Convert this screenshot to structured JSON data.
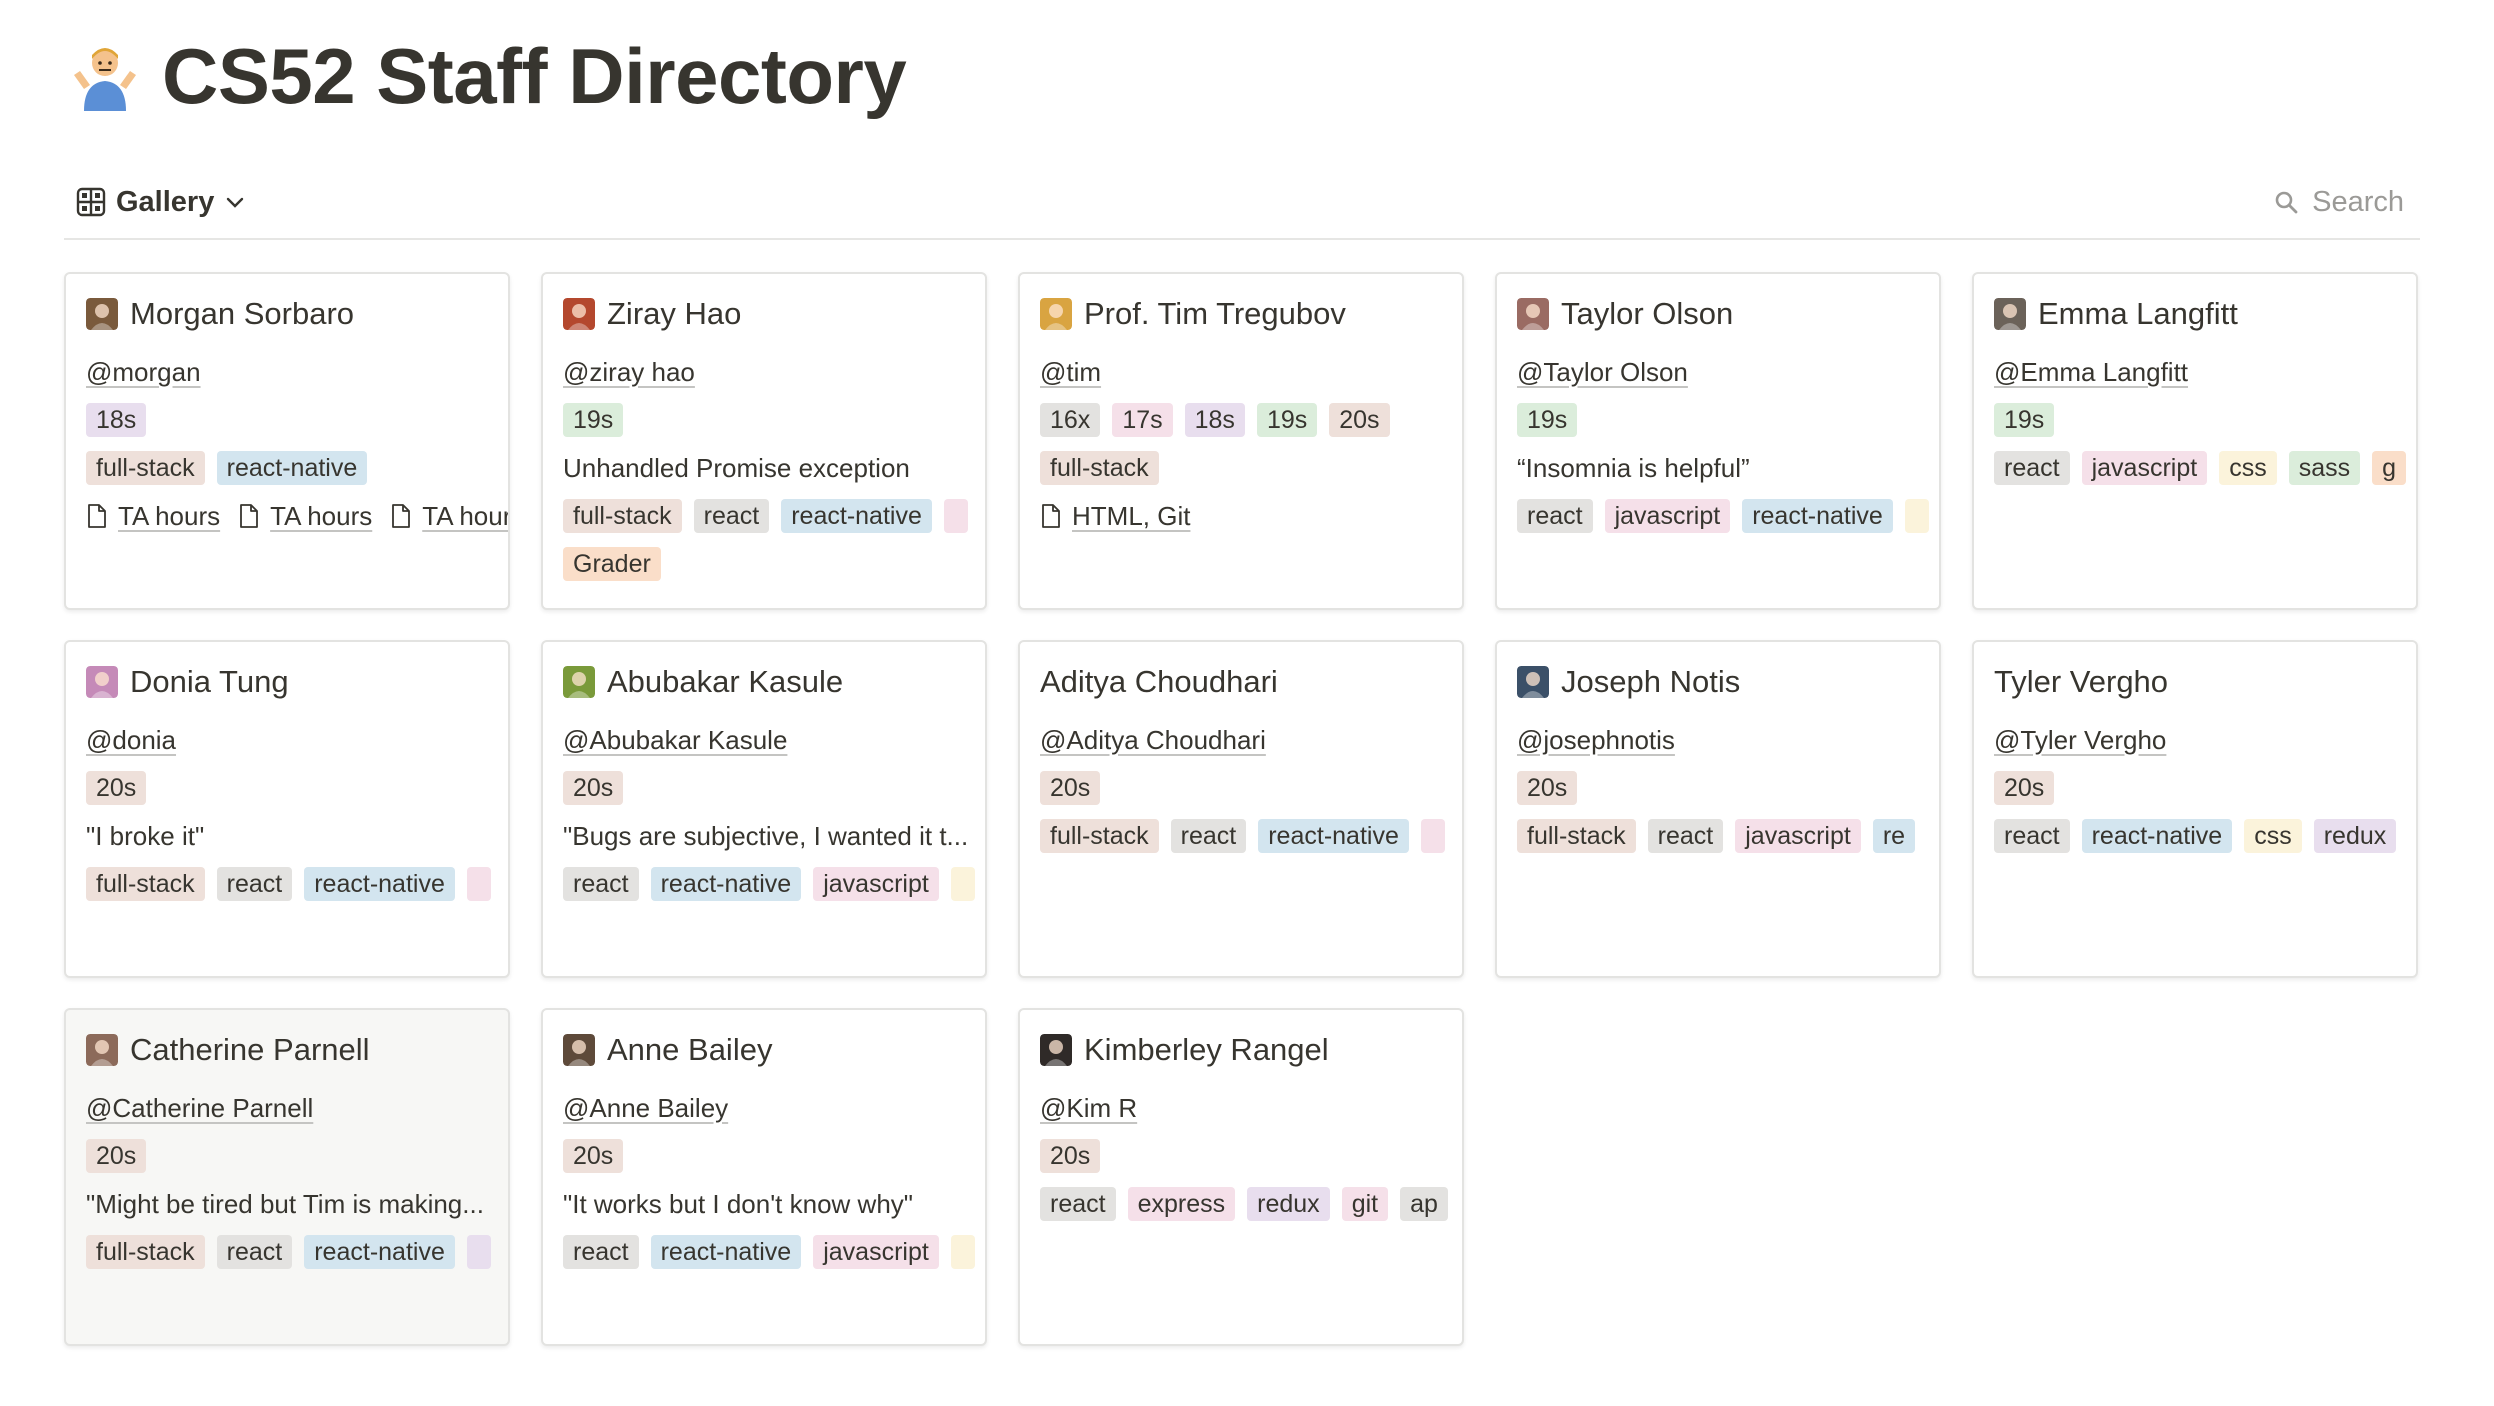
{
  "page": {
    "emoji": "person-shrugging",
    "title": "CS52 Staff Directory"
  },
  "view": {
    "label": "Gallery",
    "icon": "gallery-icon"
  },
  "search": {
    "label": "Search"
  },
  "colors": {
    "gray": "#e3e2e0",
    "brown": "#eee0da",
    "orange": "#fadec9",
    "yellow": "#fbf3db",
    "green": "#dbeddb",
    "blue": "#d3e5ef",
    "purple": "#e8deee",
    "pink": "#f5e0e9",
    "red": "#ffe2dd"
  },
  "cards": [
    {
      "name": "Morgan Sorbaro",
      "avatar": "#7a5a3c",
      "handle": "@morgan",
      "lines": [
        {
          "kind": "tags",
          "items": [
            {
              "label": "18s",
              "color": "purple"
            }
          ]
        },
        {
          "kind": "tags",
          "items": [
            {
              "label": "full-stack",
              "color": "brown"
            },
            {
              "label": "react-native",
              "color": "blue"
            }
          ]
        },
        {
          "kind": "files",
          "items": [
            "TA hours",
            "TA hours",
            "TA hours"
          ]
        }
      ]
    },
    {
      "name": "Ziray Hao",
      "avatar": "#b4482e",
      "handle": "@ziray hao",
      "lines": [
        {
          "kind": "tags",
          "items": [
            {
              "label": "19s",
              "color": "green"
            }
          ]
        },
        {
          "kind": "text",
          "value": "Unhandled Promise exception"
        },
        {
          "kind": "tags",
          "items": [
            {
              "label": "full-stack",
              "color": "brown"
            },
            {
              "label": "react",
              "color": "gray"
            },
            {
              "label": "react-native",
              "color": "blue"
            },
            {
              "label": "",
              "color": "pink"
            }
          ]
        },
        {
          "kind": "tags",
          "items": [
            {
              "label": "Grader",
              "color": "orange"
            }
          ]
        }
      ]
    },
    {
      "name": "Prof. Tim Tregubov",
      "avatar": "#d9a441",
      "handle": "@tim",
      "lines": [
        {
          "kind": "tags",
          "items": [
            {
              "label": "16x",
              "color": "gray"
            },
            {
              "label": "17s",
              "color": "pink"
            },
            {
              "label": "18s",
              "color": "purple"
            },
            {
              "label": "19s",
              "color": "green"
            },
            {
              "label": "20s",
              "color": "brown"
            }
          ]
        },
        {
          "kind": "tags",
          "items": [
            {
              "label": "full-stack",
              "color": "brown"
            }
          ]
        },
        {
          "kind": "files",
          "items": [
            "HTML, Git"
          ]
        }
      ]
    },
    {
      "name": "Taylor Olson",
      "avatar": "#9a6b63",
      "handle": "@Taylor Olson",
      "lines": [
        {
          "kind": "tags",
          "items": [
            {
              "label": "19s",
              "color": "green"
            }
          ]
        },
        {
          "kind": "text",
          "value": "“Insomnia is helpful”"
        },
        {
          "kind": "tags",
          "items": [
            {
              "label": "react",
              "color": "gray"
            },
            {
              "label": "javascript",
              "color": "pink"
            },
            {
              "label": "react-native",
              "color": "blue"
            },
            {
              "label": "",
              "color": "yellow"
            }
          ]
        }
      ]
    },
    {
      "name": "Emma Langfitt",
      "avatar": "#6b6259",
      "handle": "@Emma Langfitt",
      "lines": [
        {
          "kind": "tags",
          "items": [
            {
              "label": "19s",
              "color": "green"
            }
          ]
        },
        {
          "kind": "tags",
          "items": [
            {
              "label": "react",
              "color": "gray"
            },
            {
              "label": "javascript",
              "color": "pink"
            },
            {
              "label": "css",
              "color": "yellow"
            },
            {
              "label": "sass",
              "color": "green"
            },
            {
              "label": "g",
              "color": "orange"
            }
          ]
        }
      ]
    },
    {
      "name": "Donia Tung",
      "avatar": "#c58ab8",
      "handle": "@donia",
      "lines": [
        {
          "kind": "tags",
          "items": [
            {
              "label": "20s",
              "color": "brown"
            }
          ]
        },
        {
          "kind": "text",
          "value": "\"I broke it\""
        },
        {
          "kind": "tags",
          "items": [
            {
              "label": "full-stack",
              "color": "brown"
            },
            {
              "label": "react",
              "color": "gray"
            },
            {
              "label": "react-native",
              "color": "blue"
            },
            {
              "label": "",
              "color": "pink"
            }
          ]
        }
      ]
    },
    {
      "name": "Abubakar Kasule",
      "avatar": "#7a9a3a",
      "handle": "@Abubakar Kasule",
      "lines": [
        {
          "kind": "tags",
          "items": [
            {
              "label": "20s",
              "color": "brown"
            }
          ]
        },
        {
          "kind": "text",
          "value": "\"Bugs are subjective, I wanted it t..."
        },
        {
          "kind": "tags",
          "items": [
            {
              "label": "react",
              "color": "gray"
            },
            {
              "label": "react-native",
              "color": "blue"
            },
            {
              "label": "javascript",
              "color": "pink"
            },
            {
              "label": "",
              "color": "yellow"
            }
          ]
        }
      ]
    },
    {
      "name": "Aditya Choudhari",
      "avatar": "",
      "handle": "@Aditya Choudhari",
      "lines": [
        {
          "kind": "tags",
          "items": [
            {
              "label": "20s",
              "color": "brown"
            }
          ]
        },
        {
          "kind": "tags",
          "items": [
            {
              "label": "full-stack",
              "color": "brown"
            },
            {
              "label": "react",
              "color": "gray"
            },
            {
              "label": "react-native",
              "color": "blue"
            },
            {
              "label": "",
              "color": "pink"
            }
          ]
        }
      ]
    },
    {
      "name": "Joseph Notis",
      "avatar": "#3b5068",
      "handle": "@josephnotis",
      "lines": [
        {
          "kind": "tags",
          "items": [
            {
              "label": "20s",
              "color": "brown"
            }
          ]
        },
        {
          "kind": "tags",
          "items": [
            {
              "label": "full-stack",
              "color": "brown"
            },
            {
              "label": "react",
              "color": "gray"
            },
            {
              "label": "javascript",
              "color": "pink"
            },
            {
              "label": "re",
              "color": "blue"
            }
          ]
        }
      ]
    },
    {
      "name": "Tyler Vergho",
      "avatar": "",
      "handle": "@Tyler Vergho",
      "lines": [
        {
          "kind": "tags",
          "items": [
            {
              "label": "20s",
              "color": "brown"
            }
          ]
        },
        {
          "kind": "tags",
          "items": [
            {
              "label": "react",
              "color": "gray"
            },
            {
              "label": "react-native",
              "color": "blue"
            },
            {
              "label": "css",
              "color": "yellow"
            },
            {
              "label": "redux",
              "color": "purple"
            }
          ]
        }
      ]
    },
    {
      "name": "Catherine Parnell",
      "avatar": "#8c6a5a",
      "handle": "@Catherine Parnell",
      "hover": true,
      "lines": [
        {
          "kind": "tags",
          "items": [
            {
              "label": "20s",
              "color": "brown"
            }
          ]
        },
        {
          "kind": "text",
          "value": "\"Might be tired but Tim is making..."
        },
        {
          "kind": "tags",
          "items": [
            {
              "label": "full-stack",
              "color": "brown"
            },
            {
              "label": "react",
              "color": "gray"
            },
            {
              "label": "react-native",
              "color": "blue"
            },
            {
              "label": "",
              "color": "purple"
            }
          ]
        }
      ]
    },
    {
      "name": "Anne Bailey",
      "avatar": "#5e4a3a",
      "handle": "@Anne Bailey",
      "lines": [
        {
          "kind": "tags",
          "items": [
            {
              "label": "20s",
              "color": "brown"
            }
          ]
        },
        {
          "kind": "text",
          "value": "\"It works but I don't know why\""
        },
        {
          "kind": "tags",
          "items": [
            {
              "label": "react",
              "color": "gray"
            },
            {
              "label": "react-native",
              "color": "blue"
            },
            {
              "label": "javascript",
              "color": "pink"
            },
            {
              "label": "",
              "color": "yellow"
            }
          ]
        }
      ]
    },
    {
      "name": "Kimberley Rangel",
      "avatar": "#2f2a28",
      "handle": "@Kim R",
      "lines": [
        {
          "kind": "tags",
          "items": [
            {
              "label": "20s",
              "color": "brown"
            }
          ]
        },
        {
          "kind": "tags",
          "items": [
            {
              "label": "react",
              "color": "gray"
            },
            {
              "label": "express",
              "color": "pink"
            },
            {
              "label": "redux",
              "color": "purple"
            },
            {
              "label": "git",
              "color": "pink"
            },
            {
              "label": "ap",
              "color": "gray"
            }
          ]
        }
      ]
    }
  ]
}
